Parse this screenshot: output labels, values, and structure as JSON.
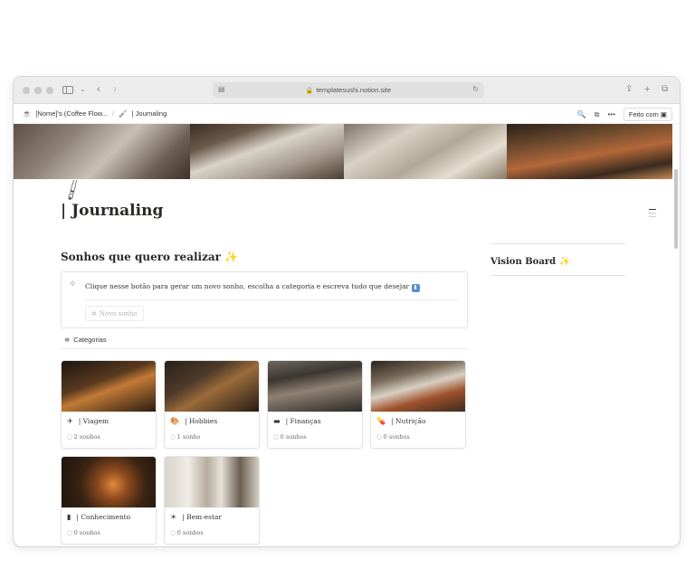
{
  "browser": {
    "url": "templatesushi.notion.site"
  },
  "notion_header": {
    "breadcrumb_1": "[Nome]'s (Coffee Flow...",
    "breadcrumb_sep": "/",
    "breadcrumb_2": "| Journaling",
    "feito_label": "Feito com"
  },
  "page": {
    "title": "| Journaling",
    "section_title": "Sonhos que quero realizar",
    "callout_text": "Clique nesse botão para gerar um novo sonho, escolha a categoria e escreva tudo que desejar",
    "new_button_label": "Novo sonho",
    "categories_label": "Categorias",
    "vision_board_title": "Vision Board"
  },
  "cards": [
    {
      "title": "| Viagem",
      "count": "2 sonhos",
      "icon": "airplane-icon"
    },
    {
      "title": "| Hobbies",
      "count": "1 sonho",
      "icon": "palette-icon"
    },
    {
      "title": "| Finanças",
      "count": "0 sonhos",
      "icon": "money-icon"
    },
    {
      "title": "| Nutrição",
      "count": "0 sonhos",
      "icon": "pill-icon"
    },
    {
      "title": "| Conhecimento",
      "count": "0 sonhos",
      "icon": "book-icon"
    },
    {
      "title": "| Bem-estar",
      "count": "0 sonhos",
      "icon": "sun-icon"
    }
  ],
  "colors": {
    "sparkle": "#f2c200",
    "arrow_badge": "#5a8fd0"
  }
}
